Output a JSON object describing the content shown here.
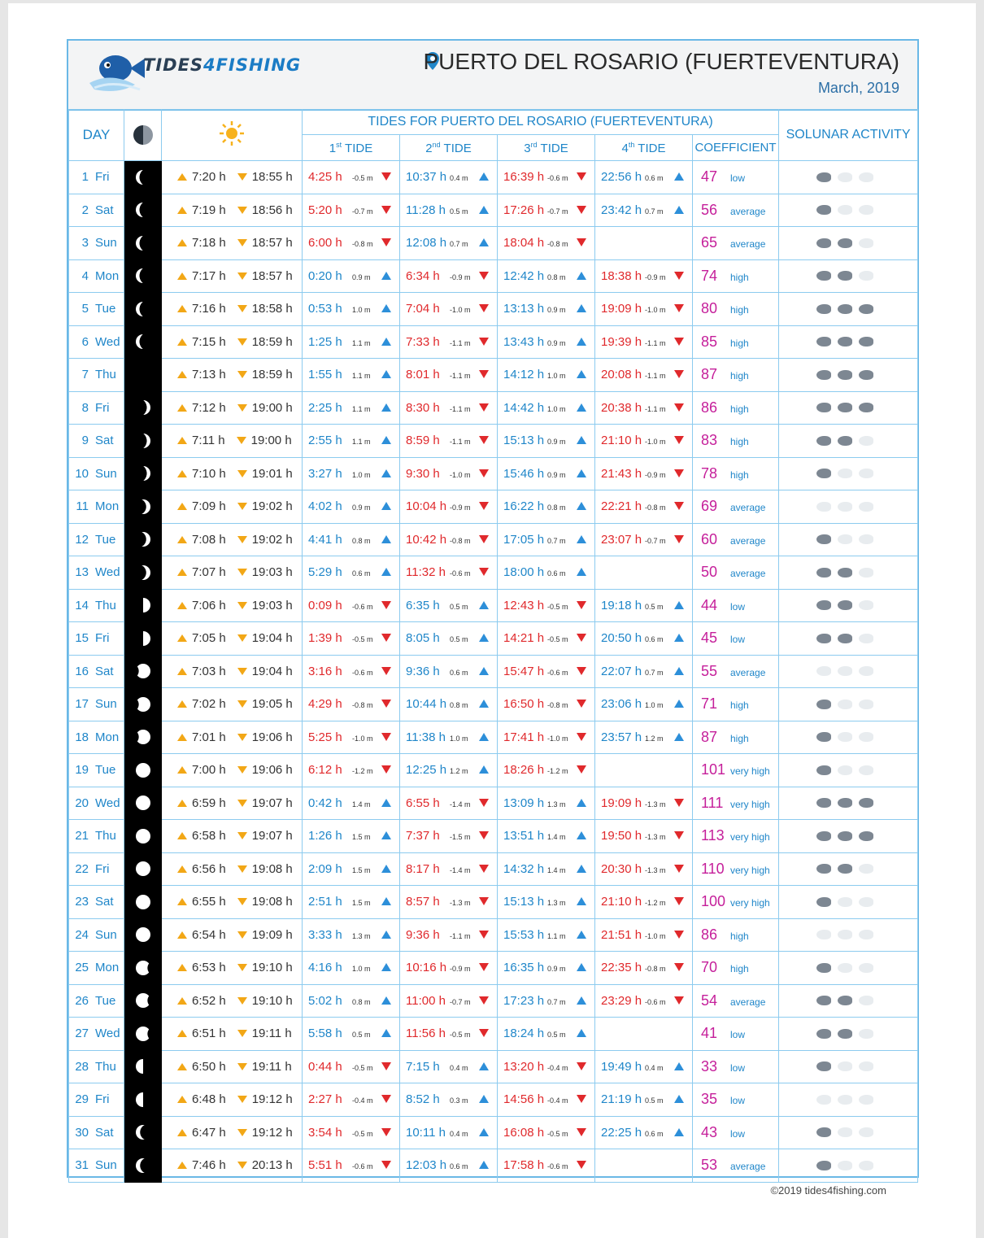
{
  "header": {
    "logo_text_a": "TIDES",
    "logo_text_b": "4",
    "logo_text_c": "FISHING",
    "place": "PUERTO DEL ROSARIO (FUERTEVENTURA)",
    "month": "March, 2019"
  },
  "columns": {
    "day": "DAY",
    "tides_title": "TIDES FOR PUERTO DEL ROSARIO (FUERTEVENTURA)",
    "tide1": "TIDE",
    "tide1_ord": "1st",
    "tide2": "TIDE",
    "tide2_ord": "2nd",
    "tide3": "TIDE",
    "tide3_ord": "3rd",
    "tide4": "TIDE",
    "tide4_ord": "4th",
    "coefficient": "COEFFICIENT",
    "solunar": "SOLUNAR ACTIVITY"
  },
  "colors": {
    "border": "#6ab8e6",
    "high": "#1f86c9",
    "low": "#e0292c",
    "coef": "#c51f9a",
    "sun": "#f2a716"
  },
  "rows": [
    {
      "d": "1",
      "w": "Fri",
      "moon": "waning-crescent-thin",
      "sr": "7:20",
      "ss": "18:55",
      "t": [
        [
          "4:25",
          "-0.5 m",
          "L"
        ],
        [
          "10:37",
          "0.4 m",
          "H"
        ],
        [
          "16:39",
          "-0.6 m",
          "L"
        ],
        [
          "22:56",
          "0.6 m",
          "H"
        ]
      ],
      "c": "47",
      "cw": "low",
      "f": 1
    },
    {
      "d": "2",
      "w": "Sat",
      "moon": "waning-crescent-thin",
      "sr": "7:19",
      "ss": "18:56",
      "t": [
        [
          "5:20",
          "-0.7 m",
          "L"
        ],
        [
          "11:28",
          "0.5 m",
          "H"
        ],
        [
          "17:26",
          "-0.7 m",
          "L"
        ],
        [
          "23:42",
          "0.7 m",
          "H"
        ]
      ],
      "c": "56",
      "cw": "average",
      "f": 1
    },
    {
      "d": "3",
      "w": "Sun",
      "moon": "waning-crescent-thin",
      "sr": "7:18",
      "ss": "18:57",
      "t": [
        [
          "6:00",
          "-0.8 m",
          "L"
        ],
        [
          "12:08",
          "0.7 m",
          "H"
        ],
        [
          "18:04",
          "-0.8 m",
          "L"
        ],
        null
      ],
      "c": "65",
      "cw": "average",
      "f": 2
    },
    {
      "d": "4",
      "w": "Mon",
      "moon": "waning-crescent-thin",
      "sr": "7:17",
      "ss": "18:57",
      "t": [
        [
          "0:20",
          "0.9 m",
          "H"
        ],
        [
          "6:34",
          "-0.9 m",
          "L"
        ],
        [
          "12:42",
          "0.8 m",
          "H"
        ],
        [
          "18:38",
          "-0.9 m",
          "L"
        ]
      ],
      "c": "74",
      "cw": "high",
      "f": 2
    },
    {
      "d": "5",
      "w": "Tue",
      "moon": "waning-crescent-thin",
      "sr": "7:16",
      "ss": "18:58",
      "t": [
        [
          "0:53",
          "1.0 m",
          "H"
        ],
        [
          "7:04",
          "-1.0 m",
          "L"
        ],
        [
          "13:13",
          "0.9 m",
          "H"
        ],
        [
          "19:09",
          "-1.0 m",
          "L"
        ]
      ],
      "c": "80",
      "cw": "high",
      "f": 3
    },
    {
      "d": "6",
      "w": "Wed",
      "moon": "waning-crescent-thin",
      "sr": "7:15",
      "ss": "18:59",
      "t": [
        [
          "1:25",
          "1.1 m",
          "H"
        ],
        [
          "7:33",
          "-1.1 m",
          "L"
        ],
        [
          "13:43",
          "0.9 m",
          "H"
        ],
        [
          "19:39",
          "-1.1 m",
          "L"
        ]
      ],
      "c": "85",
      "cw": "high",
      "f": 3
    },
    {
      "d": "7",
      "w": "Thu",
      "moon": "new",
      "sr": "7:13",
      "ss": "18:59",
      "t": [
        [
          "1:55",
          "1.1 m",
          "H"
        ],
        [
          "8:01",
          "-1.1 m",
          "L"
        ],
        [
          "14:12",
          "1.0 m",
          "H"
        ],
        [
          "20:08",
          "-1.1 m",
          "L"
        ]
      ],
      "c": "87",
      "cw": "high",
      "f": 3
    },
    {
      "d": "8",
      "w": "Fri",
      "moon": "waxing-crescent-thin",
      "sr": "7:12",
      "ss": "19:00",
      "t": [
        [
          "2:25",
          "1.1 m",
          "H"
        ],
        [
          "8:30",
          "-1.1 m",
          "L"
        ],
        [
          "14:42",
          "1.0 m",
          "H"
        ],
        [
          "20:38",
          "-1.1 m",
          "L"
        ]
      ],
      "c": "86",
      "cw": "high",
      "f": 3
    },
    {
      "d": "9",
      "w": "Sat",
      "moon": "waxing-crescent-thin",
      "sr": "7:11",
      "ss": "19:00",
      "t": [
        [
          "2:55",
          "1.1 m",
          "H"
        ],
        [
          "8:59",
          "-1.1 m",
          "L"
        ],
        [
          "15:13",
          "0.9 m",
          "H"
        ],
        [
          "21:10",
          "-1.0 m",
          "L"
        ]
      ],
      "c": "83",
      "cw": "high",
      "f": 2
    },
    {
      "d": "10",
      "w": "Sun",
      "moon": "waxing-crescent-thin",
      "sr": "7:10",
      "ss": "19:01",
      "t": [
        [
          "3:27",
          "1.0 m",
          "H"
        ],
        [
          "9:30",
          "-1.0 m",
          "L"
        ],
        [
          "15:46",
          "0.9 m",
          "H"
        ],
        [
          "21:43",
          "-0.9 m",
          "L"
        ]
      ],
      "c": "78",
      "cw": "high",
      "f": 1
    },
    {
      "d": "11",
      "w": "Mon",
      "moon": "waxing-crescent",
      "sr": "7:09",
      "ss": "19:02",
      "t": [
        [
          "4:02",
          "0.9 m",
          "H"
        ],
        [
          "10:04",
          "-0.9 m",
          "L"
        ],
        [
          "16:22",
          "0.8 m",
          "H"
        ],
        [
          "22:21",
          "-0.8 m",
          "L"
        ]
      ],
      "c": "69",
      "cw": "average",
      "f": 0
    },
    {
      "d": "12",
      "w": "Tue",
      "moon": "waxing-crescent",
      "sr": "7:08",
      "ss": "19:02",
      "t": [
        [
          "4:41",
          "0.8 m",
          "H"
        ],
        [
          "10:42",
          "-0.8 m",
          "L"
        ],
        [
          "17:05",
          "0.7 m",
          "H"
        ],
        [
          "23:07",
          "-0.7 m",
          "L"
        ]
      ],
      "c": "60",
      "cw": "average",
      "f": 1
    },
    {
      "d": "13",
      "w": "Wed",
      "moon": "waxing-crescent",
      "sr": "7:07",
      "ss": "19:03",
      "t": [
        [
          "5:29",
          "0.6 m",
          "H"
        ],
        [
          "11:32",
          "-0.6 m",
          "L"
        ],
        [
          "18:00",
          "0.6 m",
          "H"
        ],
        null
      ],
      "c": "50",
      "cw": "average",
      "f": 2
    },
    {
      "d": "14",
      "w": "Thu",
      "moon": "first-quarter",
      "sr": "7:06",
      "ss": "19:03",
      "t": [
        [
          "0:09",
          "-0.6 m",
          "L"
        ],
        [
          "6:35",
          "0.5 m",
          "H"
        ],
        [
          "12:43",
          "-0.5 m",
          "L"
        ],
        [
          "19:18",
          "0.5 m",
          "H"
        ]
      ],
      "c": "44",
      "cw": "low",
      "f": 2
    },
    {
      "d": "15",
      "w": "Fri",
      "moon": "first-quarter",
      "sr": "7:05",
      "ss": "19:04",
      "t": [
        [
          "1:39",
          "-0.5 m",
          "L"
        ],
        [
          "8:05",
          "0.5 m",
          "H"
        ],
        [
          "14:21",
          "-0.5 m",
          "L"
        ],
        [
          "20:50",
          "0.6 m",
          "H"
        ]
      ],
      "c": "45",
      "cw": "low",
      "f": 2
    },
    {
      "d": "16",
      "w": "Sat",
      "moon": "waxing-gibbous",
      "sr": "7:03",
      "ss": "19:04",
      "t": [
        [
          "3:16",
          "-0.6 m",
          "L"
        ],
        [
          "9:36",
          "0.6 m",
          "H"
        ],
        [
          "15:47",
          "-0.6 m",
          "L"
        ],
        [
          "22:07",
          "0.7 m",
          "H"
        ]
      ],
      "c": "55",
      "cw": "average",
      "f": 0
    },
    {
      "d": "17",
      "w": "Sun",
      "moon": "waxing-gibbous",
      "sr": "7:02",
      "ss": "19:05",
      "t": [
        [
          "4:29",
          "-0.8 m",
          "L"
        ],
        [
          "10:44",
          "0.8 m",
          "H"
        ],
        [
          "16:50",
          "-0.8 m",
          "L"
        ],
        [
          "23:06",
          "1.0 m",
          "H"
        ]
      ],
      "c": "71",
      "cw": "high",
      "f": 1
    },
    {
      "d": "18",
      "w": "Mon",
      "moon": "waxing-gibbous",
      "sr": "7:01",
      "ss": "19:06",
      "t": [
        [
          "5:25",
          "-1.0 m",
          "L"
        ],
        [
          "11:38",
          "1.0 m",
          "H"
        ],
        [
          "17:41",
          "-1.0 m",
          "L"
        ],
        [
          "23:57",
          "1.2 m",
          "H"
        ]
      ],
      "c": "87",
      "cw": "high",
      "f": 1
    },
    {
      "d": "19",
      "w": "Tue",
      "moon": "full",
      "sr": "7:00",
      "ss": "19:06",
      "t": [
        [
          "6:12",
          "-1.2 m",
          "L"
        ],
        [
          "12:25",
          "1.2 m",
          "H"
        ],
        [
          "18:26",
          "-1.2 m",
          "L"
        ],
        null
      ],
      "c": "101",
      "cw": "very high",
      "f": 1
    },
    {
      "d": "20",
      "w": "Wed",
      "moon": "full",
      "sr": "6:59",
      "ss": "19:07",
      "t": [
        [
          "0:42",
          "1.4 m",
          "H"
        ],
        [
          "6:55",
          "-1.4 m",
          "L"
        ],
        [
          "13:09",
          "1.3 m",
          "H"
        ],
        [
          "19:09",
          "-1.3 m",
          "L"
        ]
      ],
      "c": "111",
      "cw": "very high",
      "f": 3
    },
    {
      "d": "21",
      "w": "Thu",
      "moon": "full",
      "sr": "6:58",
      "ss": "19:07",
      "t": [
        [
          "1:26",
          "1.5 m",
          "H"
        ],
        [
          "7:37",
          "-1.5 m",
          "L"
        ],
        [
          "13:51",
          "1.4 m",
          "H"
        ],
        [
          "19:50",
          "-1.3 m",
          "L"
        ]
      ],
      "c": "113",
      "cw": "very high",
      "f": 3
    },
    {
      "d": "22",
      "w": "Fri",
      "moon": "full",
      "sr": "6:56",
      "ss": "19:08",
      "t": [
        [
          "2:09",
          "1.5 m",
          "H"
        ],
        [
          "8:17",
          "-1.4 m",
          "L"
        ],
        [
          "14:32",
          "1.4 m",
          "H"
        ],
        [
          "20:30",
          "-1.3 m",
          "L"
        ]
      ],
      "c": "110",
      "cw": "very high",
      "f": 2
    },
    {
      "d": "23",
      "w": "Sat",
      "moon": "full",
      "sr": "6:55",
      "ss": "19:08",
      "t": [
        [
          "2:51",
          "1.5 m",
          "H"
        ],
        [
          "8:57",
          "-1.3 m",
          "L"
        ],
        [
          "15:13",
          "1.3 m",
          "H"
        ],
        [
          "21:10",
          "-1.2 m",
          "L"
        ]
      ],
      "c": "100",
      "cw": "very high",
      "f": 1
    },
    {
      "d": "24",
      "w": "Sun",
      "moon": "full",
      "sr": "6:54",
      "ss": "19:09",
      "t": [
        [
          "3:33",
          "1.3 m",
          "H"
        ],
        [
          "9:36",
          "-1.1 m",
          "L"
        ],
        [
          "15:53",
          "1.1 m",
          "H"
        ],
        [
          "21:51",
          "-1.0 m",
          "L"
        ]
      ],
      "c": "86",
      "cw": "high",
      "f": 0
    },
    {
      "d": "25",
      "w": "Mon",
      "moon": "waning-gibbous",
      "sr": "6:53",
      "ss": "19:10",
      "t": [
        [
          "4:16",
          "1.0 m",
          "H"
        ],
        [
          "10:16",
          "-0.9 m",
          "L"
        ],
        [
          "16:35",
          "0.9 m",
          "H"
        ],
        [
          "22:35",
          "-0.8 m",
          "L"
        ]
      ],
      "c": "70",
      "cw": "high",
      "f": 1
    },
    {
      "d": "26",
      "w": "Tue",
      "moon": "waning-gibbous",
      "sr": "6:52",
      "ss": "19:10",
      "t": [
        [
          "5:02",
          "0.8 m",
          "H"
        ],
        [
          "11:00",
          "-0.7 m",
          "L"
        ],
        [
          "17:23",
          "0.7 m",
          "H"
        ],
        [
          "23:29",
          "-0.6 m",
          "L"
        ]
      ],
      "c": "54",
      "cw": "average",
      "f": 2
    },
    {
      "d": "27",
      "w": "Wed",
      "moon": "waning-gibbous",
      "sr": "6:51",
      "ss": "19:11",
      "t": [
        [
          "5:58",
          "0.5 m",
          "H"
        ],
        [
          "11:56",
          "-0.5 m",
          "L"
        ],
        [
          "18:24",
          "0.5 m",
          "H"
        ],
        null
      ],
      "c": "41",
      "cw": "low",
      "f": 2
    },
    {
      "d": "28",
      "w": "Thu",
      "moon": "last-quarter",
      "sr": "6:50",
      "ss": "19:11",
      "t": [
        [
          "0:44",
          "-0.5 m",
          "L"
        ],
        [
          "7:15",
          "0.4 m",
          "H"
        ],
        [
          "13:20",
          "-0.4 m",
          "L"
        ],
        [
          "19:49",
          "0.4 m",
          "H"
        ]
      ],
      "c": "33",
      "cw": "low",
      "f": 1
    },
    {
      "d": "29",
      "w": "Fri",
      "moon": "last-quarter",
      "sr": "6:48",
      "ss": "19:12",
      "t": [
        [
          "2:27",
          "-0.4 m",
          "L"
        ],
        [
          "8:52",
          "0.3 m",
          "H"
        ],
        [
          "14:56",
          "-0.4 m",
          "L"
        ],
        [
          "21:19",
          "0.5 m",
          "H"
        ]
      ],
      "c": "35",
      "cw": "low",
      "f": 0
    },
    {
      "d": "30",
      "w": "Sat",
      "moon": "waning-crescent",
      "sr": "6:47",
      "ss": "19:12",
      "t": [
        [
          "3:54",
          "-0.5 m",
          "L"
        ],
        [
          "10:11",
          "0.4 m",
          "H"
        ],
        [
          "16:08",
          "-0.5 m",
          "L"
        ],
        [
          "22:25",
          "0.6 m",
          "H"
        ]
      ],
      "c": "43",
      "cw": "low",
      "f": 1
    },
    {
      "d": "31",
      "w": "Sun",
      "moon": "waning-crescent",
      "sr": "7:46",
      "ss": "20:13",
      "t": [
        [
          "5:51",
          "-0.6 m",
          "L"
        ],
        [
          "12:03",
          "0.6 m",
          "H"
        ],
        [
          "17:58",
          "-0.6 m",
          "L"
        ],
        null
      ],
      "c": "53",
      "cw": "average",
      "f": 1
    }
  ],
  "footer": "©2019  tides4fishing.com"
}
